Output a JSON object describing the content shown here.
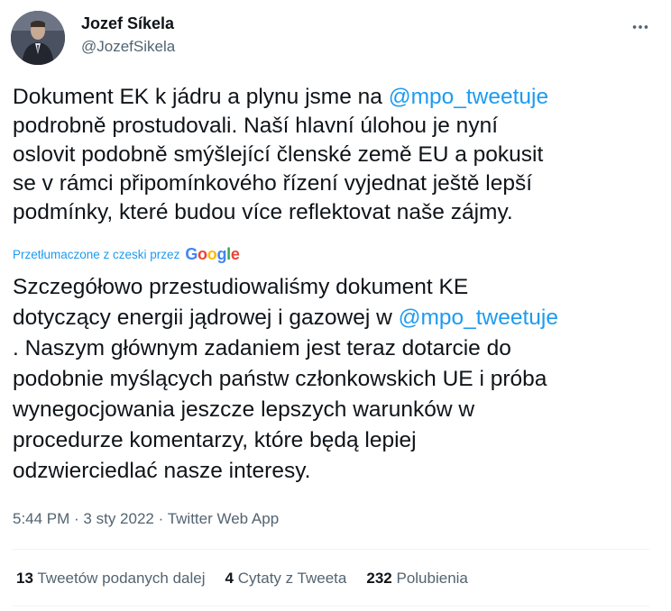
{
  "user": {
    "name": "Jozef Síkela",
    "handle": "@JozefSikela"
  },
  "tweet": {
    "lines": [
      [
        "Dokument EK k jádru a plynu jsme na ",
        "@mpo_tweetuje",
        ""
      ],
      [
        "podrobně prostudovali. Naší hlavní úlohou je nyní",
        "",
        ""
      ],
      [
        "oslovit podobně smýšlející členské země EU a pokusit",
        "",
        ""
      ],
      [
        "se v rámci připomínkového řízení vyjednat ještě lepší",
        "",
        ""
      ],
      [
        "podmínky, které budou více reflektovat naše zájmy.",
        "",
        ""
      ]
    ]
  },
  "translation": {
    "attribution": "Przetłumaczone z czeski przez",
    "provider": "Google",
    "lines": [
      [
        "Szczegółowo przestudiowaliśmy dokument KE",
        "",
        ""
      ],
      [
        "dotyczący energii jądrowej i gazowej w ",
        "@mpo_tweetuje",
        ""
      ],
      [
        ". Naszym głównym zadaniem jest teraz dotarcie do",
        "",
        ""
      ],
      [
        "podobnie myślących państw członkowskich UE i próba",
        "",
        ""
      ],
      [
        "wynegocjowania jeszcze lepszych warunków w",
        "",
        ""
      ],
      [
        "procedurze komentarzy, które będą lepiej",
        "",
        ""
      ],
      [
        "odzwierciedlać nasze interesy.",
        "",
        ""
      ]
    ]
  },
  "meta": {
    "time": "5:44 PM",
    "separator": " · ",
    "date": "3 sty 2022",
    "source": "Twitter Web App"
  },
  "stats": {
    "retweets_count": "13",
    "retweets_label": "Tweetów podanych dalej",
    "quotes_count": "4",
    "quotes_label": "Cytaty z Tweeta",
    "likes_count": "232",
    "likes_label": "Polubienia"
  },
  "colors": {
    "accent": "#1d9bf0",
    "text": "#0f1419",
    "secondary": "#536471"
  },
  "icons": {
    "more": "more-horizontal-icon"
  }
}
